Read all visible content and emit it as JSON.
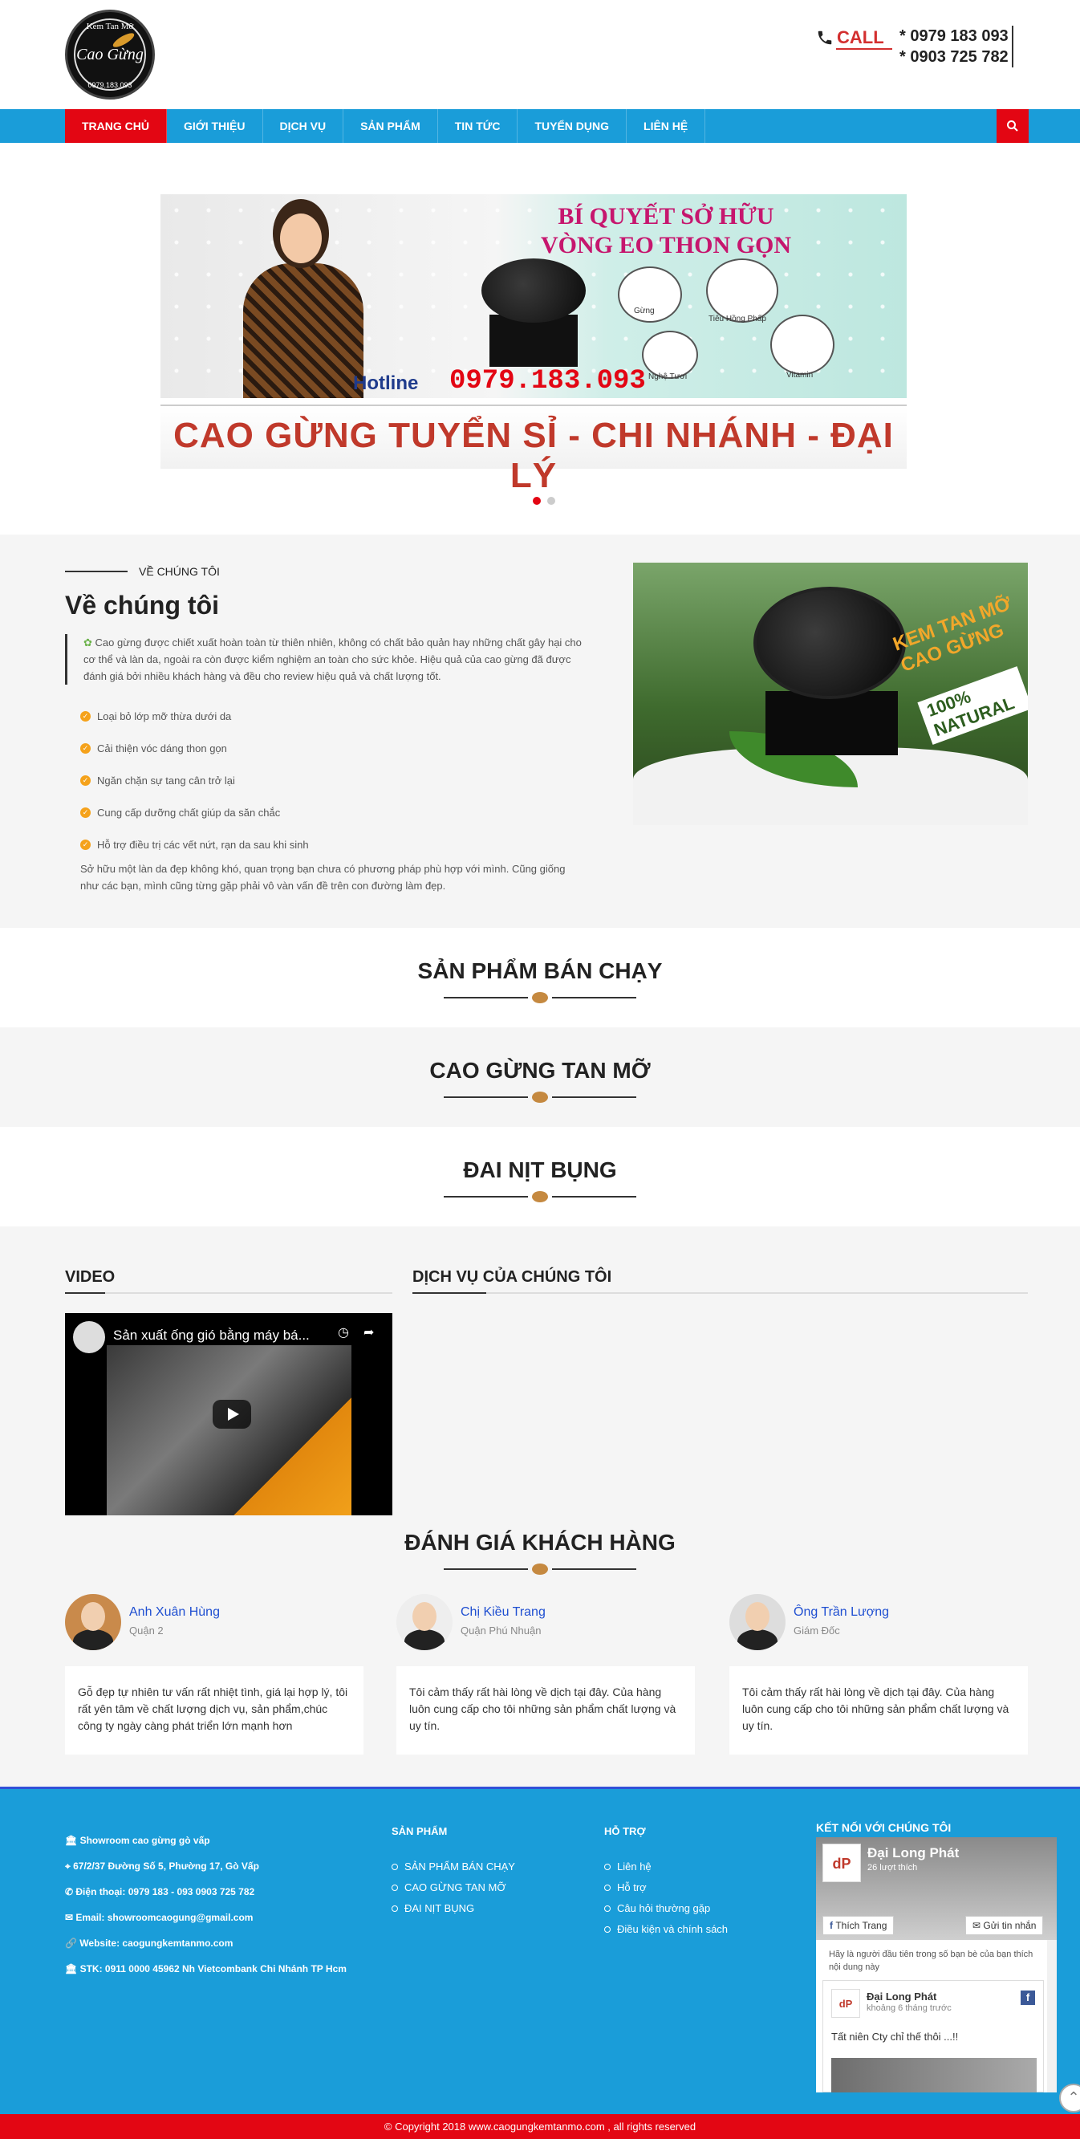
{
  "header": {
    "logo": {
      "top": "Kem Tan Mỡ",
      "mid": "Cao Gừng",
      "bot": "0979.183.093"
    },
    "call_label": "CALL",
    "phones": [
      "* 0979 183 093",
      "* 0903 725 782"
    ]
  },
  "nav": {
    "items": [
      "TRANG CHỦ",
      "GIỚI THIỆU",
      "DỊCH VỤ",
      "SẢN PHẨM",
      "TIN TỨC",
      "TUYỂN DỤNG",
      "LIÊN HỆ"
    ],
    "active_index": 0,
    "search_icon": "search-icon"
  },
  "banner": {
    "title_line1": "BÍ QUYẾT SỞ HỮU",
    "title_line2": "VÒNG EO THON GỌN",
    "hotline_label": "Hotline",
    "hotline_number": "0979.183.093",
    "ingredients": [
      "Gừng",
      "Tiêu Hồng Phấp",
      "Nghệ Tươi",
      "Vitamin"
    ],
    "bottom_text": "CAO GỪNG TUYỂN SỈ - CHI NHÁNH - ĐẠI LÝ",
    "slide_count": 2,
    "active_slide": 0
  },
  "about": {
    "label": "VỀ CHÚNG TÔI",
    "title": "Về chúng tôi",
    "intro": "Cao gừng được chiết xuất hoàn toàn từ thiên nhiên, không có chất bảo quản hay những chất gây hại cho cơ thể và làn da, ngoài ra còn được kiểm nghiệm an toàn cho sức khỏe. Hiệu quả của cao gừng đã được đánh giá bởi nhiều khách hàng và đều cho review hiệu quả và chất lượng tốt.",
    "bullets": [
      "Loại bỏ lớp mỡ thừa dưới da",
      "Cải thiện vóc dáng thon gọn",
      "Ngăn chặn sự tang cân trở lại",
      "Cung cấp dưỡng chất giúp da săn chắc",
      "Hỗ trợ điều trị các vết nứt, rạn da sau khi sinh"
    ],
    "footer_text": "Sở hữu một làn da đẹp không khó, quan trọng bạn chưa có phương pháp phù hợp với mình. Cũng giống như các bạn, mình cũng từng gặp phải vô vàn vấn đề trên con đường làm đẹp.",
    "image_text1": "KEM TAN MỠ CAO GỪNG",
    "image_text2": "100% NATURAL"
  },
  "sections": {
    "best_sellers": "SẢN PHẨM BÁN CHẠY",
    "cao_gung": "CAO GỪNG TAN MỠ",
    "dai_nit": "ĐAI NỊT BỤNG"
  },
  "video": {
    "heading": "VIDEO",
    "title": "Sản xuất ống gió bằng máy bá...",
    "services_heading": "DỊCH VỤ CỦA CHÚNG TÔI"
  },
  "reviews": {
    "heading": "ĐÁNH GIÁ KHÁCH HÀNG",
    "items": [
      {
        "name": "Anh Xuân Hùng",
        "role": "Quận 2",
        "text": "Gỗ đẹp tự nhiên tư vấn rất nhiệt tình, giá lại hợp lý, tôi rất yên tâm về chất lượng dịch vụ, sản phẩm,chúc công ty ngày càng phát triển lớn mạnh hơn"
      },
      {
        "name": "Chị Kiều Trang",
        "role": "Quận Phú Nhuận",
        "text": "Tôi cảm thấy rất hài lòng về dịch tại đây. Của hàng luôn cung cấp cho tôi những sản phẩm chất lượng và uy tín."
      },
      {
        "name": "Ông Trần Lượng",
        "role": "Giám Đốc",
        "text": "Tôi cảm thấy rất hài lòng về dịch tại đây. Của hàng luôn cung cấp cho tôi những sản phẩm chất lượng và uy tín."
      }
    ]
  },
  "footer": {
    "showroom": "Showroom cao gừng gò vấp",
    "address": "67/2/37 Đường Số 5, Phường 17, Gò Vấp",
    "phone": "Điện thoại: 0979 183 - 093 0903 725 782",
    "email": "Email: showroomcaogung@gmail.com",
    "website": "Website: caogungkemtanmo.com",
    "bank": "STK: 0911 0000 45962  Nh Vietcombank Chi Nhánh  TP Hcm",
    "products_heading": "SẢN PHẨM",
    "products": [
      "SẢN PHẨM BÁN CHẠY",
      "CAO GỪNG TAN MỠ",
      "ĐAI NỊT BỤNG"
    ],
    "support_heading": "HỖ TRỢ",
    "support": [
      "Liên hệ",
      "Hỗ trợ",
      "Câu hỏi thường gặp",
      "Điều kiện và chính sách"
    ],
    "connect_heading": "KẾT NỐI VỚI CHÚNG TÔI",
    "fb": {
      "page_name": "Đại Long Phát",
      "likes": "26 lượt thích",
      "like_button": "Thích Trang",
      "message_button": "Gửi tin nhắn",
      "share_text": "Hãy là người đầu tiên trong số bạn bè của bạn thích nội dung này",
      "post_author": "Đại Long Phát",
      "post_time": "khoảng 6 tháng trước",
      "post_text": "Tất niên Cty chỉ thế thôi ...!!",
      "logo_text": "dP"
    },
    "copyright": "© Copyright 2018 www.caogungkemtanmo.com , all rights reserved"
  },
  "colors": {
    "nav_blue": "#1a9dd9",
    "accent_red": "#e30613",
    "footer_blue": "#1a9dd9"
  }
}
